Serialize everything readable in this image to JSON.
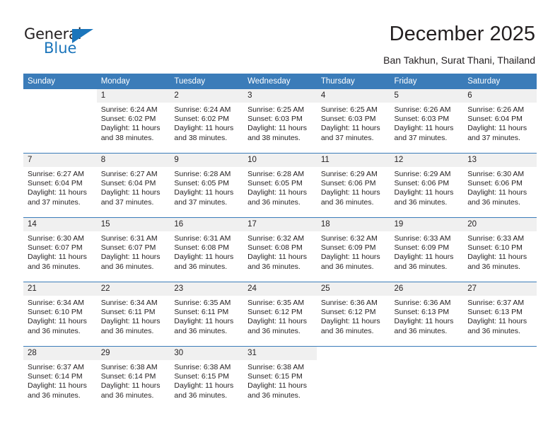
{
  "logo": {
    "word_top": "General",
    "word_bottom": "Blue",
    "triangle_icon": "triangle-icon",
    "color_dark": "#231f20",
    "color_blue": "#1b75bb"
  },
  "header": {
    "title": "December 2025",
    "subtitle": "Ban Takhun, Surat Thani, Thailand"
  },
  "colors": {
    "header_row_bg": "#3b7cb9",
    "daynum_bg": "#f0f0f0",
    "text": "#231f20",
    "page_bg": "#ffffff"
  },
  "calendar": {
    "weekday_headers": [
      "Sunday",
      "Monday",
      "Tuesday",
      "Wednesday",
      "Thursday",
      "Friday",
      "Saturday"
    ],
    "weeks": [
      [
        {
          "day": "",
          "sunrise": "",
          "sunset": "",
          "daylight_line1": "",
          "daylight_line2": ""
        },
        {
          "day": "1",
          "sunrise": "Sunrise: 6:24 AM",
          "sunset": "Sunset: 6:02 PM",
          "daylight_line1": "Daylight: 11 hours",
          "daylight_line2": "and 38 minutes."
        },
        {
          "day": "2",
          "sunrise": "Sunrise: 6:24 AM",
          "sunset": "Sunset: 6:02 PM",
          "daylight_line1": "Daylight: 11 hours",
          "daylight_line2": "and 38 minutes."
        },
        {
          "day": "3",
          "sunrise": "Sunrise: 6:25 AM",
          "sunset": "Sunset: 6:03 PM",
          "daylight_line1": "Daylight: 11 hours",
          "daylight_line2": "and 38 minutes."
        },
        {
          "day": "4",
          "sunrise": "Sunrise: 6:25 AM",
          "sunset": "Sunset: 6:03 PM",
          "daylight_line1": "Daylight: 11 hours",
          "daylight_line2": "and 37 minutes."
        },
        {
          "day": "5",
          "sunrise": "Sunrise: 6:26 AM",
          "sunset": "Sunset: 6:03 PM",
          "daylight_line1": "Daylight: 11 hours",
          "daylight_line2": "and 37 minutes."
        },
        {
          "day": "6",
          "sunrise": "Sunrise: 6:26 AM",
          "sunset": "Sunset: 6:04 PM",
          "daylight_line1": "Daylight: 11 hours",
          "daylight_line2": "and 37 minutes."
        }
      ],
      [
        {
          "day": "7",
          "sunrise": "Sunrise: 6:27 AM",
          "sunset": "Sunset: 6:04 PM",
          "daylight_line1": "Daylight: 11 hours",
          "daylight_line2": "and 37 minutes."
        },
        {
          "day": "8",
          "sunrise": "Sunrise: 6:27 AM",
          "sunset": "Sunset: 6:04 PM",
          "daylight_line1": "Daylight: 11 hours",
          "daylight_line2": "and 37 minutes."
        },
        {
          "day": "9",
          "sunrise": "Sunrise: 6:28 AM",
          "sunset": "Sunset: 6:05 PM",
          "daylight_line1": "Daylight: 11 hours",
          "daylight_line2": "and 37 minutes."
        },
        {
          "day": "10",
          "sunrise": "Sunrise: 6:28 AM",
          "sunset": "Sunset: 6:05 PM",
          "daylight_line1": "Daylight: 11 hours",
          "daylight_line2": "and 36 minutes."
        },
        {
          "day": "11",
          "sunrise": "Sunrise: 6:29 AM",
          "sunset": "Sunset: 6:06 PM",
          "daylight_line1": "Daylight: 11 hours",
          "daylight_line2": "and 36 minutes."
        },
        {
          "day": "12",
          "sunrise": "Sunrise: 6:29 AM",
          "sunset": "Sunset: 6:06 PM",
          "daylight_line1": "Daylight: 11 hours",
          "daylight_line2": "and 36 minutes."
        },
        {
          "day": "13",
          "sunrise": "Sunrise: 6:30 AM",
          "sunset": "Sunset: 6:06 PM",
          "daylight_line1": "Daylight: 11 hours",
          "daylight_line2": "and 36 minutes."
        }
      ],
      [
        {
          "day": "14",
          "sunrise": "Sunrise: 6:30 AM",
          "sunset": "Sunset: 6:07 PM",
          "daylight_line1": "Daylight: 11 hours",
          "daylight_line2": "and 36 minutes."
        },
        {
          "day": "15",
          "sunrise": "Sunrise: 6:31 AM",
          "sunset": "Sunset: 6:07 PM",
          "daylight_line1": "Daylight: 11 hours",
          "daylight_line2": "and 36 minutes."
        },
        {
          "day": "16",
          "sunrise": "Sunrise: 6:31 AM",
          "sunset": "Sunset: 6:08 PM",
          "daylight_line1": "Daylight: 11 hours",
          "daylight_line2": "and 36 minutes."
        },
        {
          "day": "17",
          "sunrise": "Sunrise: 6:32 AM",
          "sunset": "Sunset: 6:08 PM",
          "daylight_line1": "Daylight: 11 hours",
          "daylight_line2": "and 36 minutes."
        },
        {
          "day": "18",
          "sunrise": "Sunrise: 6:32 AM",
          "sunset": "Sunset: 6:09 PM",
          "daylight_line1": "Daylight: 11 hours",
          "daylight_line2": "and 36 minutes."
        },
        {
          "day": "19",
          "sunrise": "Sunrise: 6:33 AM",
          "sunset": "Sunset: 6:09 PM",
          "daylight_line1": "Daylight: 11 hours",
          "daylight_line2": "and 36 minutes."
        },
        {
          "day": "20",
          "sunrise": "Sunrise: 6:33 AM",
          "sunset": "Sunset: 6:10 PM",
          "daylight_line1": "Daylight: 11 hours",
          "daylight_line2": "and 36 minutes."
        }
      ],
      [
        {
          "day": "21",
          "sunrise": "Sunrise: 6:34 AM",
          "sunset": "Sunset: 6:10 PM",
          "daylight_line1": "Daylight: 11 hours",
          "daylight_line2": "and 36 minutes."
        },
        {
          "day": "22",
          "sunrise": "Sunrise: 6:34 AM",
          "sunset": "Sunset: 6:11 PM",
          "daylight_line1": "Daylight: 11 hours",
          "daylight_line2": "and 36 minutes."
        },
        {
          "day": "23",
          "sunrise": "Sunrise: 6:35 AM",
          "sunset": "Sunset: 6:11 PM",
          "daylight_line1": "Daylight: 11 hours",
          "daylight_line2": "and 36 minutes."
        },
        {
          "day": "24",
          "sunrise": "Sunrise: 6:35 AM",
          "sunset": "Sunset: 6:12 PM",
          "daylight_line1": "Daylight: 11 hours",
          "daylight_line2": "and 36 minutes."
        },
        {
          "day": "25",
          "sunrise": "Sunrise: 6:36 AM",
          "sunset": "Sunset: 6:12 PM",
          "daylight_line1": "Daylight: 11 hours",
          "daylight_line2": "and 36 minutes."
        },
        {
          "day": "26",
          "sunrise": "Sunrise: 6:36 AM",
          "sunset": "Sunset: 6:13 PM",
          "daylight_line1": "Daylight: 11 hours",
          "daylight_line2": "and 36 minutes."
        },
        {
          "day": "27",
          "sunrise": "Sunrise: 6:37 AM",
          "sunset": "Sunset: 6:13 PM",
          "daylight_line1": "Daylight: 11 hours",
          "daylight_line2": "and 36 minutes."
        }
      ],
      [
        {
          "day": "28",
          "sunrise": "Sunrise: 6:37 AM",
          "sunset": "Sunset: 6:14 PM",
          "daylight_line1": "Daylight: 11 hours",
          "daylight_line2": "and 36 minutes."
        },
        {
          "day": "29",
          "sunrise": "Sunrise: 6:38 AM",
          "sunset": "Sunset: 6:14 PM",
          "daylight_line1": "Daylight: 11 hours",
          "daylight_line2": "and 36 minutes."
        },
        {
          "day": "30",
          "sunrise": "Sunrise: 6:38 AM",
          "sunset": "Sunset: 6:15 PM",
          "daylight_line1": "Daylight: 11 hours",
          "daylight_line2": "and 36 minutes."
        },
        {
          "day": "31",
          "sunrise": "Sunrise: 6:38 AM",
          "sunset": "Sunset: 6:15 PM",
          "daylight_line1": "Daylight: 11 hours",
          "daylight_line2": "and 36 minutes."
        },
        {
          "day": "",
          "sunrise": "",
          "sunset": "",
          "daylight_line1": "",
          "daylight_line2": ""
        },
        {
          "day": "",
          "sunrise": "",
          "sunset": "",
          "daylight_line1": "",
          "daylight_line2": ""
        },
        {
          "day": "",
          "sunrise": "",
          "sunset": "",
          "daylight_line1": "",
          "daylight_line2": ""
        }
      ]
    ]
  }
}
